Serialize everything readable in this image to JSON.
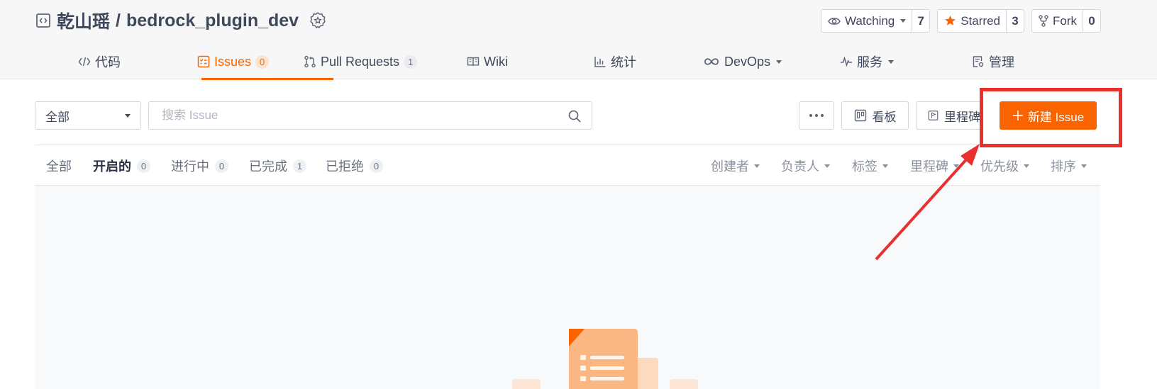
{
  "repo": {
    "owner": "乾山瑶",
    "separator": "/",
    "name": "bedrock_plugin_dev"
  },
  "actions": {
    "watch": {
      "label": "Watching",
      "count": "7"
    },
    "star": {
      "label": "Starred",
      "count": "3"
    },
    "fork": {
      "label": "Fork",
      "count": "0"
    }
  },
  "nav": {
    "code": "代码",
    "issues": {
      "label": "Issues",
      "count": "0"
    },
    "pulls": {
      "label": "Pull Requests",
      "count": "1"
    },
    "wiki": "Wiki",
    "stats": "统计",
    "devops": "DevOps",
    "services": "服务",
    "manage": "管理"
  },
  "toolbar": {
    "filter_value": "全部",
    "search_placeholder": "搜索 Issue",
    "board_label": "看板",
    "milestone_label": "里程碑",
    "new_issue_label": "新建 Issue"
  },
  "states": [
    {
      "label": "全部",
      "count": ""
    },
    {
      "label": "开启的",
      "count": "0"
    },
    {
      "label": "进行中",
      "count": "0"
    },
    {
      "label": "已完成",
      "count": "1"
    },
    {
      "label": "已拒绝",
      "count": "0"
    }
  ],
  "filters": {
    "creator": "创建者",
    "assignee": "负责人",
    "label": "标签",
    "milestone": "里程碑",
    "priority": "优先级",
    "sort": "排序"
  },
  "colors": {
    "accent": "#fa6400",
    "annotation": "#e8302f"
  }
}
